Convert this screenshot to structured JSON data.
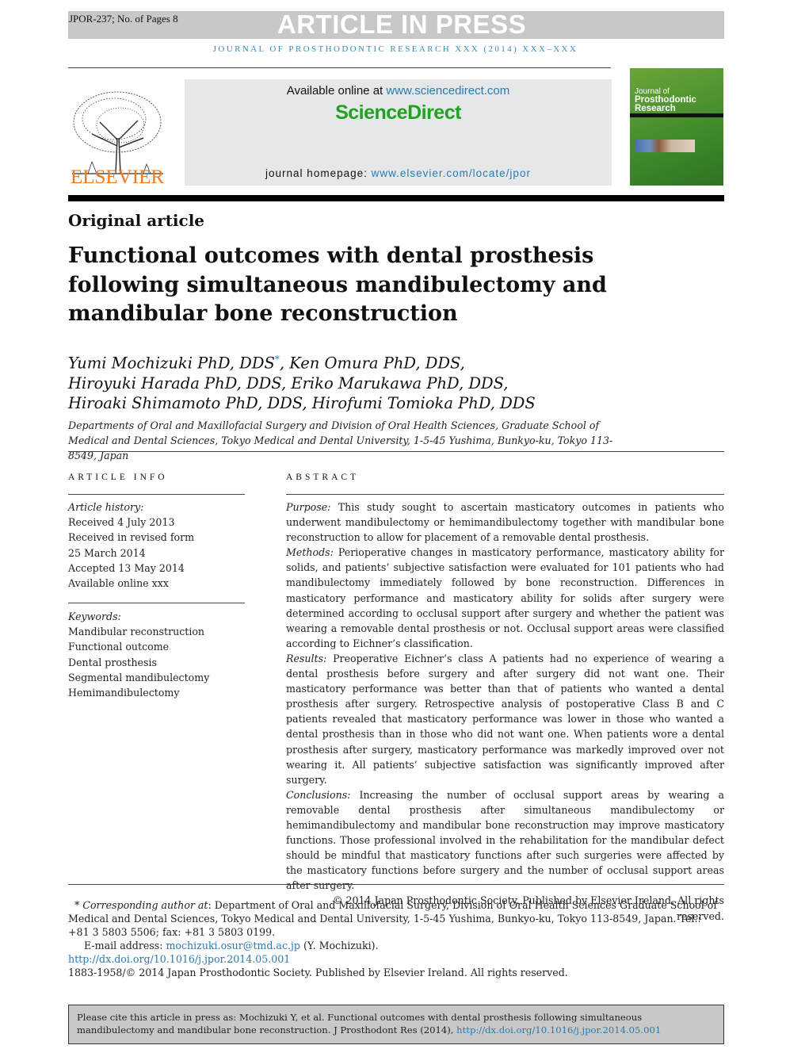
{
  "header": {
    "doc_id": "JPOR-237; No. of Pages 8",
    "banner": "ARTICLE IN PRESS",
    "journal_line": "JOURNAL OF PROSTHODONTIC RESEARCH XXX (2014) XXX–XXX"
  },
  "masthead": {
    "publisher": "ELSEVIER",
    "available_prefix": "Available online at ",
    "available_link": "www.sciencedirect.com",
    "sd_logo": "ScienceDirect",
    "homepage_prefix": "journal homepage: ",
    "homepage_link": "www.elsevier.com/locate/jpor",
    "cover_line1": "Journal of",
    "cover_line2": "Prosthodontic",
    "cover_line3": "Research"
  },
  "article": {
    "type": "Original article",
    "title": "Functional outcomes with dental prosthesis following simultaneous mandibulectomy and mandibular bone reconstruction",
    "authors_line1a": "Yumi Mochizuki PhD, DDS",
    "authors_star": "*",
    "authors_line1b": ", Ken Omura PhD, DDS,",
    "authors_line2": "Hiroyuki Harada PhD, DDS, Eriko Marukawa PhD, DDS,",
    "authors_line3": "Hiroaki Shimamoto PhD, DDS, Hirofumi Tomioka PhD, DDS",
    "affiliation": "Departments of Oral and Maxillofacial Surgery and Division of Oral Health Sciences, Graduate School of Medical and Dental Sciences, Tokyo Medical and Dental University, 1-5-45 Yushima, Bunkyo-ku, Tokyo 113-8549, Japan"
  },
  "article_info": {
    "heading": "ARTICLE INFO",
    "history_label": "Article history:",
    "history": [
      "Received 4 July 2013",
      "Received in revised form",
      "25 March 2014",
      "Accepted 13 May 2014",
      "Available online xxx"
    ],
    "keywords_label": "Keywords:",
    "keywords": [
      "Mandibular reconstruction",
      "Functional outcome",
      "Dental prosthesis",
      "Segmental mandibulectomy",
      "Hemimandibulectomy"
    ]
  },
  "abstract": {
    "heading": "ABSTRACT",
    "purpose_label": "Purpose:",
    "purpose": "This study sought to ascertain masticatory outcomes in patients who underwent mandibulectomy or hemimandibulectomy together with mandibular bone reconstruction to allow for placement of a removable dental prosthesis.",
    "methods_label": "Methods:",
    "methods": "Perioperative changes in masticatory performance, masticatory ability for solids, and patients’ subjective satisfaction were evaluated for 101 patients who had mandibulectomy immediately followed by bone reconstruction. Differences in masticatory performance and masticatory ability for solids after surgery were determined according to occlusal support after surgery and whether the patient was wearing a removable dental prosthesis or not. Occlusal support areas were classified according to Eichner’s classification.",
    "results_label": "Results:",
    "results": "Preoperative Eichner’s class A patients had no experience of wearing a dental prosthesis before surgery and after surgery did not want one. Their masticatory performance was better than that of patients who wanted a dental prosthesis after surgery. Retrospective analysis of postoperative Class B and C patients revealed that masticatory performance was lower in those who wanted a dental prosthesis than in those who did not want one. When patients wore a dental prosthesis after surgery, masticatory performance was markedly improved over not wearing it. All patients’ subjective satisfaction was significantly improved after surgery.",
    "conclusions_label": "Conclusions:",
    "conclusions": "Increasing the number of occlusal support areas by wearing a removable dental prosthesis after simultaneous mandibulectomy or hemimandibulectomy and mandibular bone reconstruction may improve masticatory functions. Those professional involved in the rehabilitation for the mandibular defect should be mindful that masticatory functions after such surgeries were affected by the masticatory functions before surgery and the number of occlusal support areas after surgery.",
    "copyright": "© 2014 Japan Prosthodontic Society. Published by Elsevier Ireland. All rights reserved."
  },
  "footnote": {
    "star": "*",
    "corr_label": "Corresponding author at",
    "corr_text": ": Department of Oral and Maxillofacial Surgery, Division of Oral Health Sciences Graduate School of Medical and Dental Sciences, Tokyo Medical and Dental University, 1-5-45 Yushima, Bunkyo-ku, Tokyo 113-8549, Japan. Tel.: +81 3 5803 5506; fax: +81 3 5803 0199.",
    "email_label": "E-mail address: ",
    "email": "mochizuki.osur@tmd.ac.jp",
    "email_name": " (Y. Mochizuki).",
    "doi": "http://dx.doi.org/10.1016/j.jpor.2014.05.001",
    "issn": "1883-1958/© 2014 Japan Prosthodontic Society. Published by Elsevier Ireland. All rights reserved."
  },
  "cite_box": {
    "text": "Please cite this article in press as: Mochizuki Y, et al. Functional outcomes with dental prosthesis following simultaneous mandibulectomy and mandibular bone reconstruction. J Prosthodont Res (2014), ",
    "link": "http://dx.doi.org/10.1016/j.jpor.2014.05.001"
  },
  "colors": {
    "link": "#2a7ab0",
    "elsevier": "#f07a1a",
    "sciencedirect": "#1fa31f",
    "banner_bg": "#c8c8c8"
  }
}
